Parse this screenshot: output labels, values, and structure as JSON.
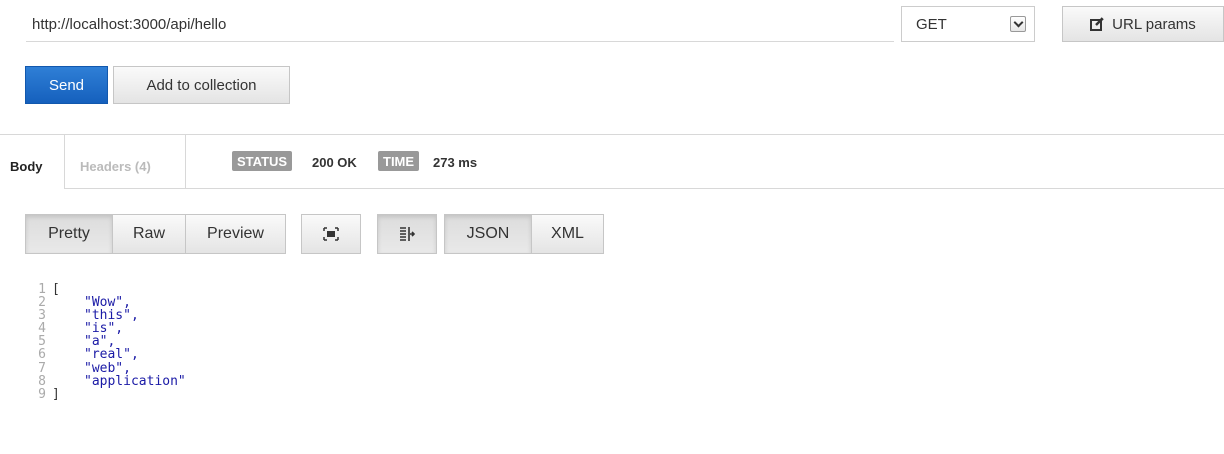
{
  "request": {
    "url": "http://localhost:3000/api/hello",
    "method": "GET",
    "url_params_label": "URL params",
    "send_label": "Send",
    "add_to_collection_label": "Add to collection"
  },
  "response_tabs": {
    "body_label": "Body",
    "headers_label": "Headers (4)",
    "status_badge": "STATUS",
    "status_value": "200 OK",
    "time_badge": "TIME",
    "time_value": "273 ms"
  },
  "view_toggles": {
    "pretty": "Pretty",
    "raw": "Raw",
    "preview": "Preview",
    "json": "JSON",
    "xml": "XML",
    "selected_view": "Pretty",
    "selected_format": "JSON"
  },
  "response_body": {
    "lines": [
      {
        "num": "1",
        "text": "["
      },
      {
        "num": "2",
        "text": "\"Wow\","
      },
      {
        "num": "3",
        "text": "\"this\","
      },
      {
        "num": "4",
        "text": "\"is\","
      },
      {
        "num": "5",
        "text": "\"a\","
      },
      {
        "num": "6",
        "text": "\"real\","
      },
      {
        "num": "7",
        "text": "\"web\","
      },
      {
        "num": "8",
        "text": "\"application\""
      },
      {
        "num": "9",
        "text": "]"
      }
    ]
  },
  "colors": {
    "send_button": "#1a66c4",
    "badge_bg": "#999999",
    "string_value": "#1a1aa6"
  },
  "icons": {
    "url_params": "edit-pencil-icon",
    "fullscreen": "fullscreen-icon",
    "wrap": "line-wrap-icon",
    "method_dropdown": "chevron-down-icon"
  }
}
